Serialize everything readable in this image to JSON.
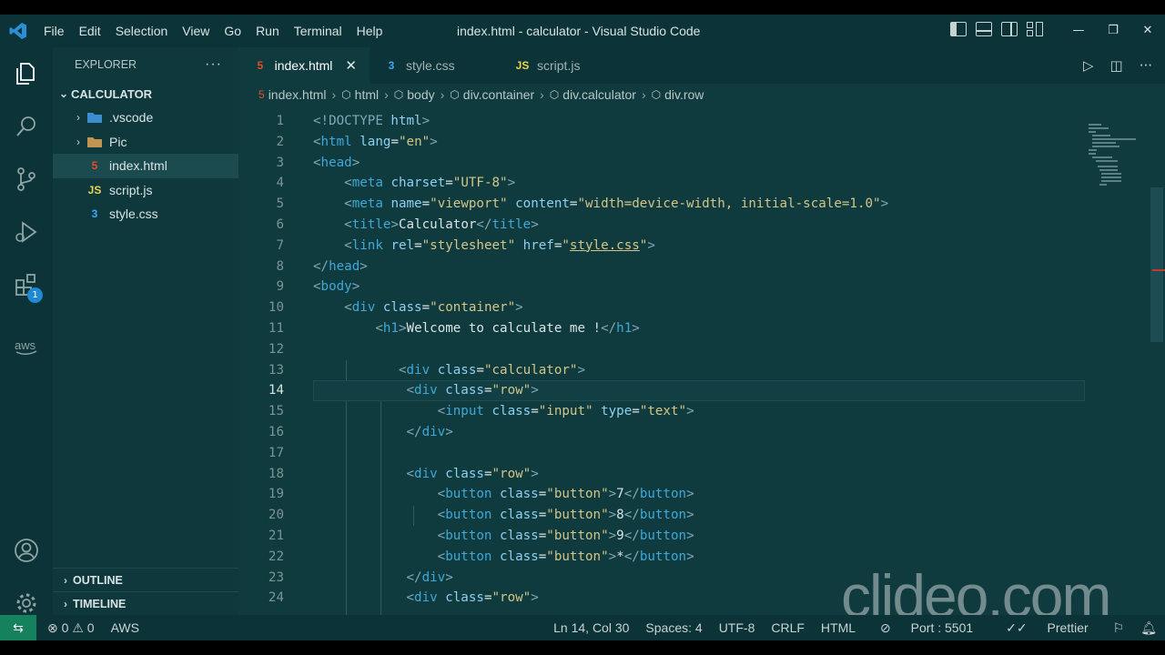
{
  "menu": [
    "File",
    "Edit",
    "Selection",
    "View",
    "Go",
    "Run",
    "Terminal",
    "Help"
  ],
  "window_title": "index.html - calculator - Visual Studio Code",
  "window_controls": [
    "—",
    "❐",
    "✕"
  ],
  "explorer": {
    "title": "EXPLORER",
    "more": "···",
    "folder": "CALCULATOR",
    "items": [
      {
        "label": ".vscode",
        "type": "folder"
      },
      {
        "label": "Pic",
        "type": "folder"
      },
      {
        "label": "index.html",
        "type": "html"
      },
      {
        "label": "script.js",
        "type": "js"
      },
      {
        "label": "style.css",
        "type": "css"
      }
    ],
    "outline": "OUTLINE",
    "timeline": "TIMELINE"
  },
  "activity_badge": "1",
  "tabs": [
    {
      "label": "index.html",
      "icon": "5",
      "close": "✕"
    },
    {
      "label": "style.css",
      "icon": "3"
    },
    {
      "label": "script.js",
      "icon": "JS"
    }
  ],
  "breadcrumb": [
    "index.html",
    "html",
    "body",
    "div.container",
    "div.calculator",
    "div.row"
  ],
  "line_numbers": [
    "1",
    "2",
    "3",
    "4",
    "5",
    "6",
    "7",
    "8",
    "9",
    "10",
    "11",
    "12",
    "13",
    "14",
    "15",
    "16",
    "17",
    "18",
    "19",
    "20",
    "21",
    "22",
    "23",
    "24"
  ],
  "watermark": "clideo.com",
  "status": {
    "errors": "0",
    "warnings": "0",
    "aws": "AWS",
    "position": "Ln 14, Col 30",
    "spaces": "Spaces: 4",
    "encoding": "UTF-8",
    "eol": "CRLF",
    "language": "HTML",
    "port": "Port : 5501",
    "prettier": "Prettier"
  },
  "colors": {
    "accent": "#16825d",
    "badge": "#1f8ad2",
    "background": "#0f3b3f"
  }
}
